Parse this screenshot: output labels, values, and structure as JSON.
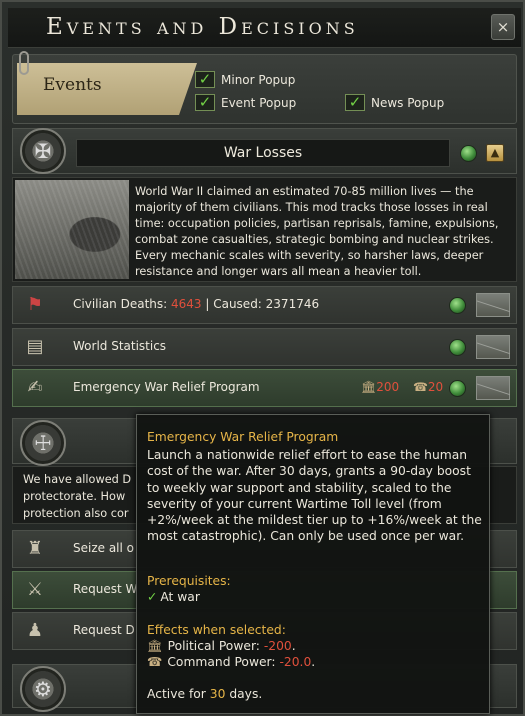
{
  "window": {
    "title": "Events and Decisions",
    "close_label": "×"
  },
  "filters": {
    "tag_label": "Events",
    "options": [
      {
        "label": "Minor Popup",
        "checked": true
      },
      {
        "label": "Event Popup",
        "checked": true
      },
      {
        "label": "News Popup",
        "checked": true
      }
    ]
  },
  "category": {
    "title": "War Losses",
    "collapse_label": "▲",
    "description": "World War II claimed an estimated 70-85 million lives — the majority of them civilians. This mod tracks those losses in real time: occupation policies, partisan reprisals, famine, expulsions, combat zone casualties, strategic bombing and nuclear strikes. Every mechanic scales with severity, so harsher laws, deeper resistance and longer wars all mean a heavier toll."
  },
  "decisions": [
    {
      "label_prefix": "Civilian Deaths: ",
      "deaths": "4643",
      "label_suffix": " | Caused: 2371746"
    },
    {
      "label": "World Statistics"
    },
    {
      "label": "Emergency War Relief Program",
      "pp_cost": "200",
      "cp_cost": "20"
    }
  ],
  "lower": {
    "desc_lines": [
      "We have allowed D",
      "protectorate. How",
      "protection also cor"
    ],
    "rows": [
      "Seize all o",
      "Request W",
      "Request D"
    ]
  },
  "tooltip": {
    "title": "Emergency War Relief Program",
    "body": "Launch a nationwide relief effort to ease the human cost of the war. After 30 days, grants a 90-day boost to weekly war support and stability, scaled to the severity of your current Wartime Toll level (from +2%/week at the mildest tier up to +16%/week at the most catastrophic). Can only be used once per war.",
    "prereq_label": "Prerequisites:",
    "prereq_item": "At war",
    "effects_label": "Effects when selected:",
    "pp_label": "Political Power: ",
    "pp_value": "-200",
    "cp_label": "Command Power: ",
    "cp_value": "-20.0",
    "active_prefix": "Active for ",
    "active_days": "30",
    "active_suffix": " days."
  }
}
